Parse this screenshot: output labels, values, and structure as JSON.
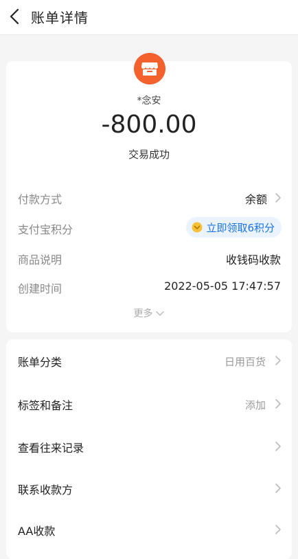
{
  "header": {
    "title": "账单详情"
  },
  "bill": {
    "merchant_name": "*念安",
    "amount": "-800.00",
    "status": "交易成功",
    "details": [
      {
        "label": "付款方式",
        "value": "余额"
      },
      {
        "label": "支付宝积分",
        "value": "立即领取6积分"
      },
      {
        "label": "商品说明",
        "value": "收钱码收款"
      },
      {
        "label": "创建时间",
        "value": "2022-05-05 17:47:57"
      }
    ],
    "more_label": "更多"
  },
  "actions": [
    {
      "label": "账单分类",
      "value": "日用百货"
    },
    {
      "label": "标签和备注",
      "value": "添加"
    },
    {
      "label": "查看往来记录",
      "value": ""
    },
    {
      "label": "联系收款方",
      "value": ""
    },
    {
      "label": "AA收款",
      "value": ""
    }
  ],
  "colors": {
    "merchant_icon_bg": "#f3612c",
    "link_blue": "#1a73e8"
  }
}
